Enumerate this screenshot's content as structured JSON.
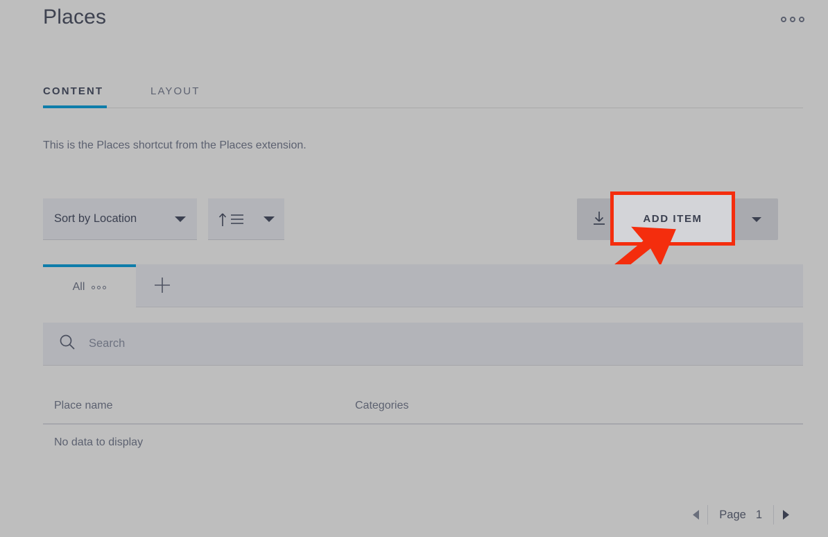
{
  "header": {
    "title": "Places",
    "overflow_menu_name": "more-options"
  },
  "tabs": [
    {
      "label": "CONTENT",
      "active": true
    },
    {
      "label": "LAYOUT",
      "active": false
    }
  ],
  "description": "This is the Places shortcut from the Places extension.",
  "toolbar": {
    "sort_by": {
      "value": "Sort by Location",
      "icon": "chevron-down-icon"
    },
    "sort_direction": {
      "icon": "sort-ascending-icon",
      "caret": "chevron-down-icon"
    },
    "download": {
      "icon": "download-icon"
    },
    "add_item": {
      "label": "ADD ITEM"
    },
    "add_item_caret": {
      "icon": "chevron-down-icon"
    }
  },
  "annotation": {
    "type": "arrow-highlight",
    "color": "#f42d0d",
    "target": "ADD ITEM"
  },
  "subtabs": {
    "items": [
      {
        "label": "All",
        "active": true,
        "menu_icon": "ellipsis-icon"
      }
    ],
    "add_label": "+"
  },
  "search": {
    "value": "",
    "placeholder": "Search",
    "icon": "search-icon"
  },
  "table": {
    "columns": [
      "Place name",
      "Categories"
    ],
    "rows": [],
    "empty_message": "No data to display"
  },
  "pagination": {
    "prev_icon": "chevron-left-icon",
    "next_icon": "chevron-right-icon",
    "page_label": "Page",
    "page_number": "1"
  },
  "colors": {
    "accent": "#0f7daa",
    "page_background": "#bebebe",
    "control_background": "#b3b4b9",
    "annotation_red": "#f42d0d",
    "text": "#3b4050"
  }
}
